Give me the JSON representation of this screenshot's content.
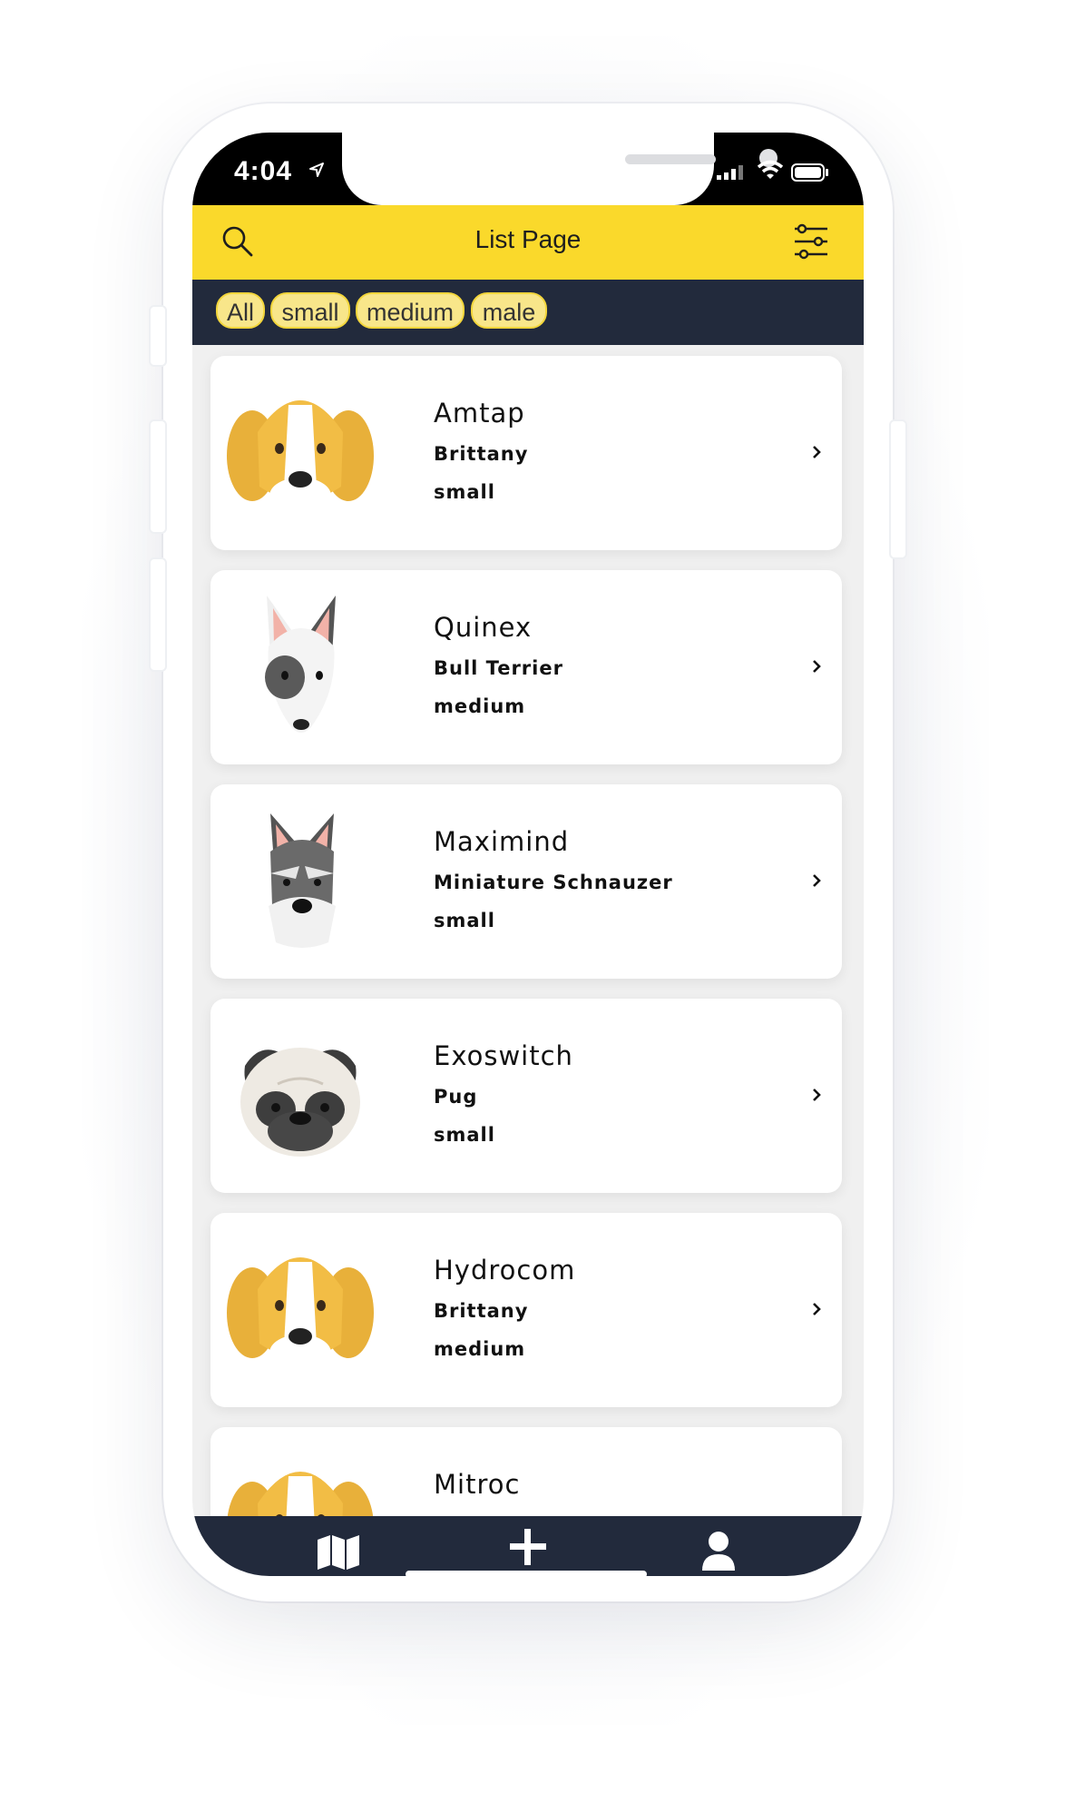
{
  "status_bar": {
    "time": "4:04"
  },
  "header": {
    "title": "List Page"
  },
  "filters": [
    "All",
    "small",
    "medium",
    "male"
  ],
  "dogs": [
    {
      "name": "Amtap",
      "breed": "Brittany",
      "size": "small",
      "avatar": "brittany"
    },
    {
      "name": "Quinex",
      "breed": "Bull Terrier",
      "size": "medium",
      "avatar": "bull-terrier"
    },
    {
      "name": "Maximind",
      "breed": "Miniature Schnauzer",
      "size": "small",
      "avatar": "schnauzer"
    },
    {
      "name": "Exoswitch",
      "breed": "Pug",
      "size": "small",
      "avatar": "pug"
    },
    {
      "name": "Hydrocom",
      "breed": "Brittany",
      "size": "medium",
      "avatar": "brittany"
    },
    {
      "name": "Mitroc",
      "breed": "",
      "size": "",
      "avatar": "brittany"
    }
  ],
  "tab_bar": {
    "items": [
      "map-icon",
      "add-icon",
      "user-icon"
    ]
  },
  "colors": {
    "accent": "#fad92b",
    "dark": "#222a3c",
    "chip_bg": "#f8e68a"
  }
}
